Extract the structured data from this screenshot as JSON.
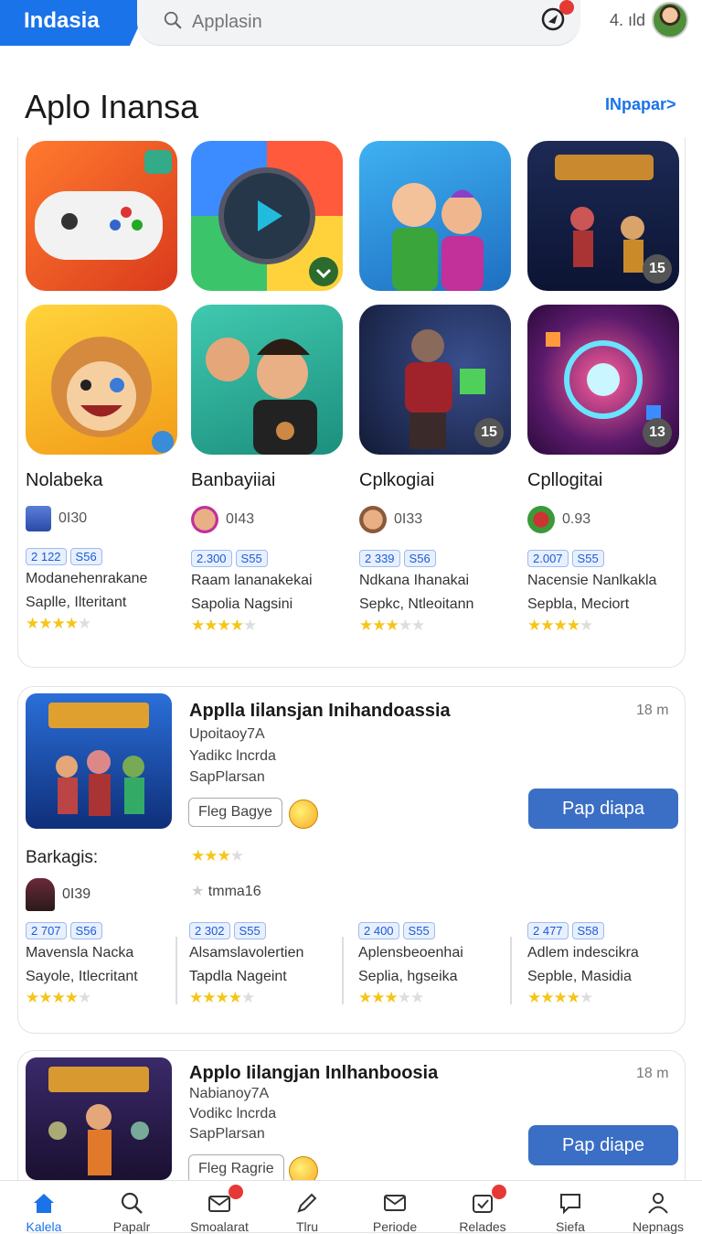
{
  "header": {
    "brand": "Indasia",
    "search_placeholder": "Applasin",
    "rating": "4. ıld"
  },
  "section": {
    "title": "Aplo Inansa",
    "link": "INpapar>"
  },
  "grid_tiles": [
    {
      "badge": ""
    },
    {
      "badge": ""
    },
    {
      "badge": ""
    },
    {
      "badge": "15"
    },
    {
      "badge": ""
    },
    {
      "badge": ""
    },
    {
      "badge": "15"
    },
    {
      "badge": "13"
    }
  ],
  "grid_apps": [
    {
      "name": "Nolabeka",
      "dev": "0I30",
      "chip1": "2 122",
      "chip2": "S56",
      "desc1": "Modanehenrakane",
      "desc2": "Saplle, Ilteritant",
      "stars": 4
    },
    {
      "name": "Banbayiiai",
      "dev": "0I43",
      "chip1": "2.300",
      "chip2": "S55",
      "desc1": "Raam lananakekai",
      "desc2": "Sapolia Nagsini",
      "stars": 4
    },
    {
      "name": "Cplkogiai",
      "dev": "0I33",
      "chip1": "2 339",
      "chip2": "S56",
      "desc1": "Ndkana Ihanakai",
      "desc2": "Sepkc, Ntleoitann",
      "stars": 3
    },
    {
      "name": "Cpllogitai",
      "dev": "0.93",
      "chip1": "2.007",
      "chip2": "S55",
      "desc1": "Nacensie Nanlkakla",
      "desc2": "Sepbla, Meciort",
      "stars": 4
    }
  ],
  "featured1": {
    "title": "Applla Iilansjan Inihandoassia",
    "time": "18 m",
    "line1": "Upoitaoy7A",
    "line2": "Yadikc lncrda",
    "line3": "SapPlarsan",
    "tag": "Fleg Bagye",
    "button": "Pap diapa",
    "section_label": "Barkagis:",
    "dev": "0I39",
    "mini": "tmma16",
    "apps": [
      {
        "chip1": "2 707",
        "chip2": "S56",
        "desc1": "Mavensla Nacka",
        "desc2": "Sayole, Itlecritant",
        "stars": 4
      },
      {
        "chip1": "2 302",
        "chip2": "S55",
        "desc1": "Alsamslavolertien",
        "desc2": "Tapdla Nageint",
        "stars": 4
      },
      {
        "chip1": "2 400",
        "chip2": "S55",
        "desc1": "Aplensbeoenhai",
        "desc2": "Seplia, hgseika",
        "stars": 3
      },
      {
        "chip1": "2 477",
        "chip2": "S58",
        "desc1": "Adlem indescikra",
        "desc2": "Sepble, Masidia",
        "stars": 4
      }
    ]
  },
  "featured2": {
    "title": "Applo Iilangjan Inlhanboosia",
    "time": "18 m",
    "line1": "Nabianoy7A",
    "line2": "Vodikc lncrda",
    "line3": "SapPlarsan",
    "tag": "Fleg Ragrie",
    "button": "Pap diape"
  },
  "nav": [
    {
      "label": "Kalela"
    },
    {
      "label": "Papalr"
    },
    {
      "label": "Smoalarat"
    },
    {
      "label": "Tlru"
    },
    {
      "label": "Periode"
    },
    {
      "label": "Relades"
    },
    {
      "label": "Siefa"
    },
    {
      "label": "Nepnags"
    }
  ],
  "colors": {
    "accent": "#1a73e8",
    "button": "#3b6fc5",
    "star": "#f5c518",
    "badge": "#e53935"
  }
}
